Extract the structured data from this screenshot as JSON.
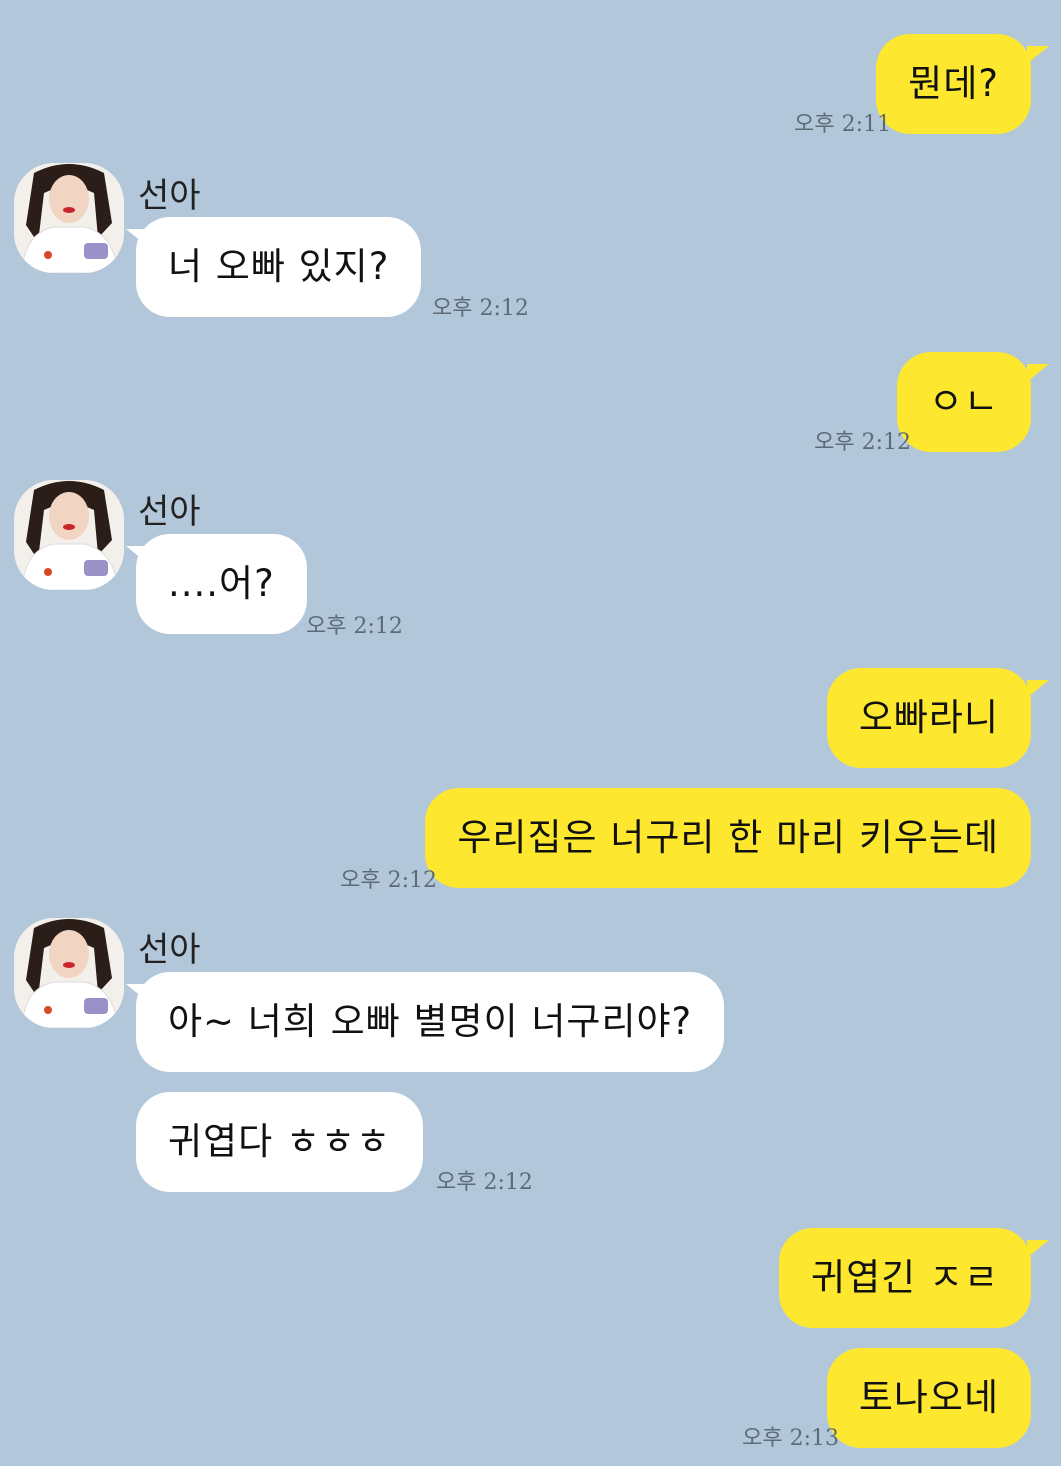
{
  "contact": {
    "name": "선아"
  },
  "messages": [
    {
      "side": "mine",
      "text": "뭔데?",
      "time": "오후 2:11"
    },
    {
      "side": "theirs",
      "text": "너 오빠 있지?",
      "time": "오후 2:12"
    },
    {
      "side": "mine",
      "text": "ㅇㄴ",
      "time": "오후 2:12"
    },
    {
      "side": "theirs",
      "text": "....어?",
      "time": "오후 2:12"
    },
    {
      "side": "mine",
      "text": "오빠라니",
      "time": ""
    },
    {
      "side": "mine",
      "text": "우리집은 너구리 한 마리 키우는데",
      "time": "오후 2:12"
    },
    {
      "side": "theirs",
      "text": "아~ 너희 오빠 별명이 너구리야?",
      "time": ""
    },
    {
      "side": "theirs",
      "text": "귀엽다 ㅎㅎㅎ",
      "time": "오후 2:12"
    },
    {
      "side": "mine",
      "text": "귀엽긴 ㅈㄹ",
      "time": ""
    },
    {
      "side": "mine",
      "text": "토나오네",
      "time": "오후 2:13"
    }
  ],
  "colors": {
    "background": "#b2c7da",
    "my_bubble": "#fee82f",
    "their_bubble": "#ffffff"
  },
  "icons": {
    "avatar": "profile-photo-avatar"
  }
}
